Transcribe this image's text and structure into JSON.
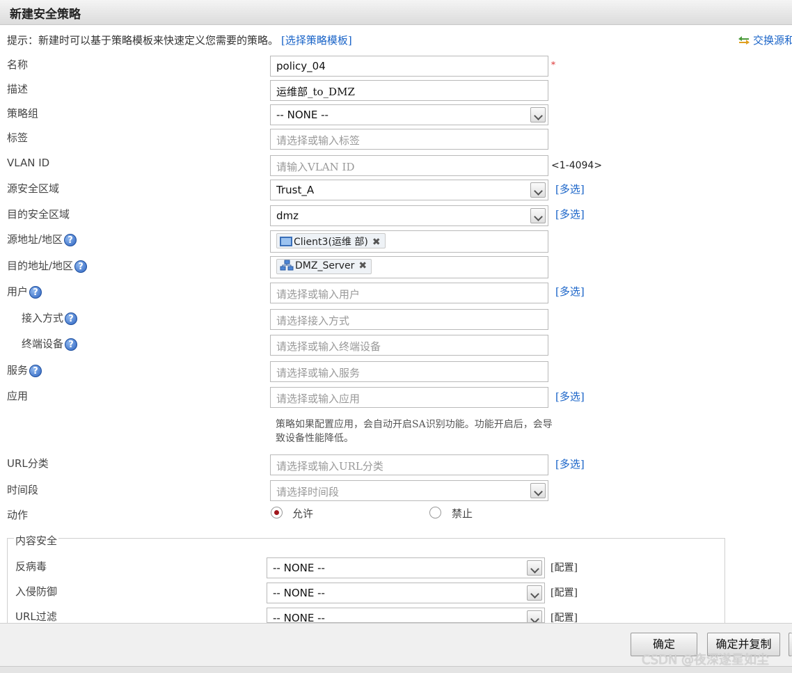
{
  "window": {
    "title": "新建安全策略"
  },
  "hint": {
    "text": "提示：新建时可以基于策略模板来快速定义您需要的策略。",
    "link": "[选择策略模板]"
  },
  "swap_link": "交换源和",
  "form": {
    "name": {
      "label": "名称",
      "value": "policy_04",
      "required_mark": "*"
    },
    "description": {
      "label": "描述",
      "value": "运维部_to_DMZ"
    },
    "policy_group": {
      "label": "策略组",
      "value": "-- NONE --"
    },
    "tags": {
      "label": "标签",
      "placeholder": "请选择或输入标签"
    },
    "vlan_id": {
      "label": "VLAN ID",
      "placeholder": "请输入VLAN ID",
      "range": "<1-4094>"
    },
    "src_zone": {
      "label": "源安全区域",
      "value": "Trust_A",
      "multi": "[多选]"
    },
    "dst_zone": {
      "label": "目的安全区域",
      "value": "dmz",
      "multi": "[多选]"
    },
    "src_addr": {
      "label": "源地址/地区",
      "tag": "Client3(运维 部)"
    },
    "dst_addr": {
      "label": "目的地址/地区",
      "tag": "DMZ_Server"
    },
    "user": {
      "label": "用户",
      "placeholder": "请选择或输入用户",
      "multi": "[多选]"
    },
    "access_method": {
      "label": "接入方式",
      "placeholder": "请选择接入方式"
    },
    "terminal": {
      "label": "终端设备",
      "placeholder": "请选择或输入终端设备"
    },
    "service": {
      "label": "服务",
      "placeholder": "请选择或输入服务"
    },
    "application": {
      "label": "应用",
      "placeholder": "请选择或输入应用",
      "multi": "[多选]",
      "note": "策略如果配置应用，会自动开启SA识别功能。功能开启后，会导致设备性能降低。"
    },
    "url_category": {
      "label": "URL分类",
      "placeholder": "请选择或输入URL分类",
      "multi": "[多选]"
    },
    "time_range": {
      "label": "时间段",
      "placeholder": "请选择时间段"
    },
    "action": {
      "label": "动作",
      "allow": "允许",
      "deny": "禁止",
      "selected": "allow"
    }
  },
  "content_security": {
    "legend": "内容安全",
    "antivirus": {
      "label": "反病毒",
      "value": "-- NONE --",
      "config": "[配置]"
    },
    "ips": {
      "label": "入侵防御",
      "value": "-- NONE --",
      "config": "[配置]"
    },
    "url_filter": {
      "label": "URL过滤",
      "value": "-- NONE --",
      "config": "[配置]"
    }
  },
  "buttons": {
    "ok": "确定",
    "ok_copy": "确定并复制"
  },
  "watermark": "CSDN @夜深遂星如尘",
  "colors": {
    "link": "#1a64c8",
    "radio_on": "#a0161c"
  }
}
